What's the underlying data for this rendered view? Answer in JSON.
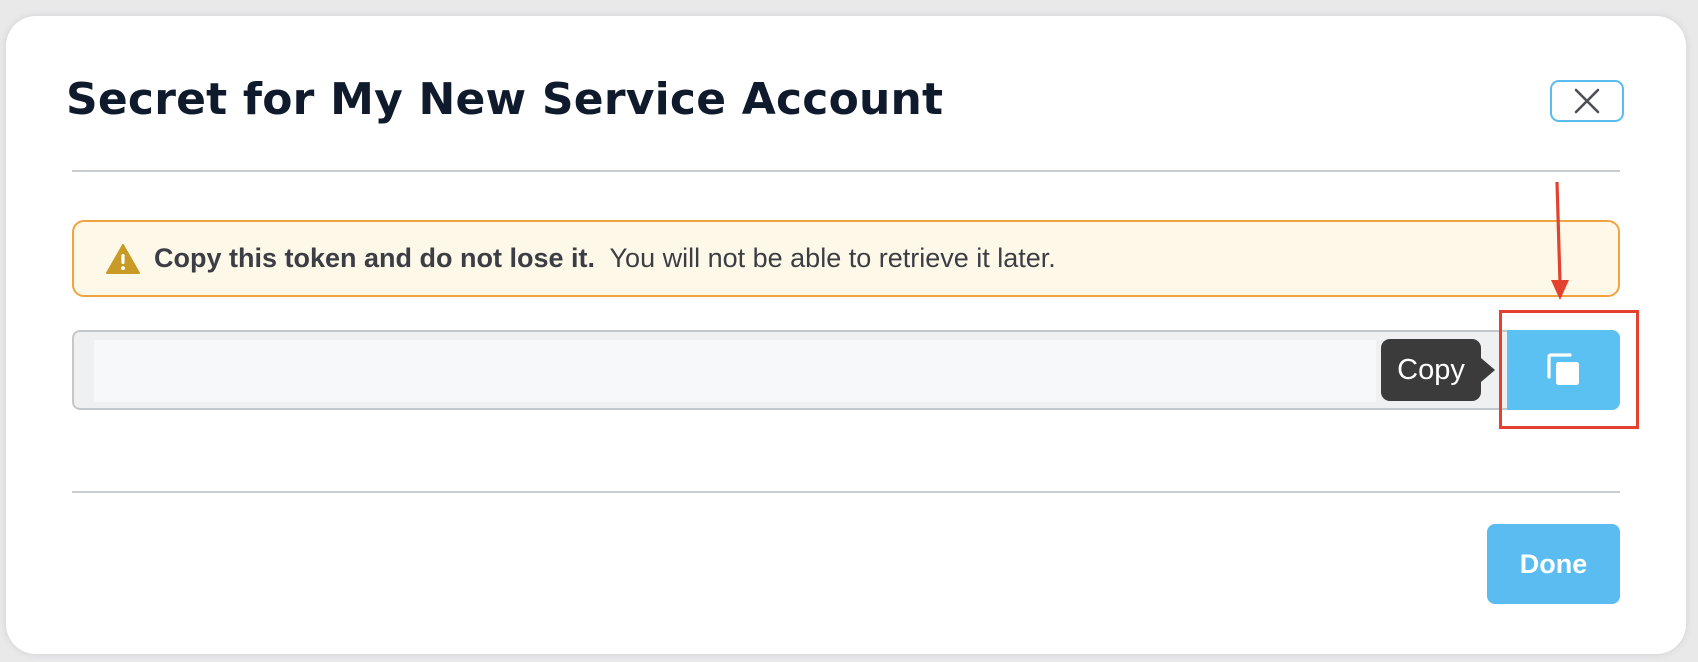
{
  "modal": {
    "title": "Secret for My New Service Account"
  },
  "alert": {
    "icon": "warning-icon",
    "strong_text": "Copy this token and do not lose it.",
    "text": "  You will not be able to retrieve it later."
  },
  "token": {
    "value": "",
    "copy_icon": "copy-icon"
  },
  "tooltip": {
    "label": "Copy"
  },
  "footer": {
    "done_label": "Done"
  },
  "annotation": {
    "highlight_color": "#e2422f"
  },
  "colors": {
    "accent": "#5bbcf2",
    "alert_border": "#f0a341",
    "alert_bg": "#fef8e8",
    "warning_icon": "#c99a25",
    "title": "#0f1b2d"
  }
}
